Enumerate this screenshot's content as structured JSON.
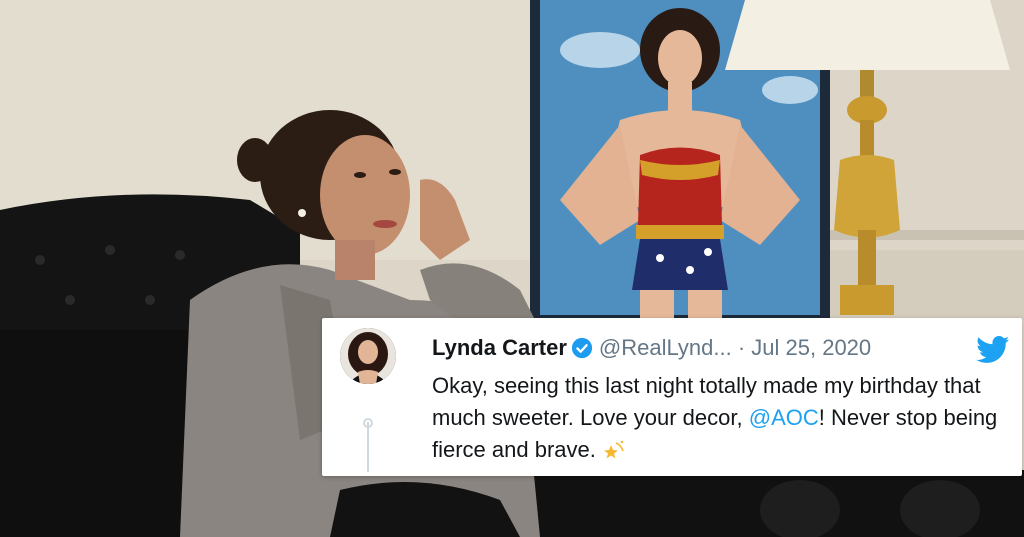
{
  "tweet": {
    "display_name": "Lynda Carter",
    "handle": "@RealLynd...",
    "separator": "·",
    "date": "Jul 25, 2020",
    "text_part1": "Okay, seeing this last night totally made my birthday that much sweeter. Love your decor, ",
    "mention": "@AOC",
    "text_part2": "! Never stop being fierce and brave.",
    "icons": [
      "verified-icon",
      "twitter-bird-icon",
      "sparkle-star-icon"
    ]
  },
  "colors": {
    "twitter_blue": "#1da1f2",
    "verified_blue": "#1d9bf0",
    "handle_gray": "#657786",
    "text_dark": "#14171a"
  }
}
